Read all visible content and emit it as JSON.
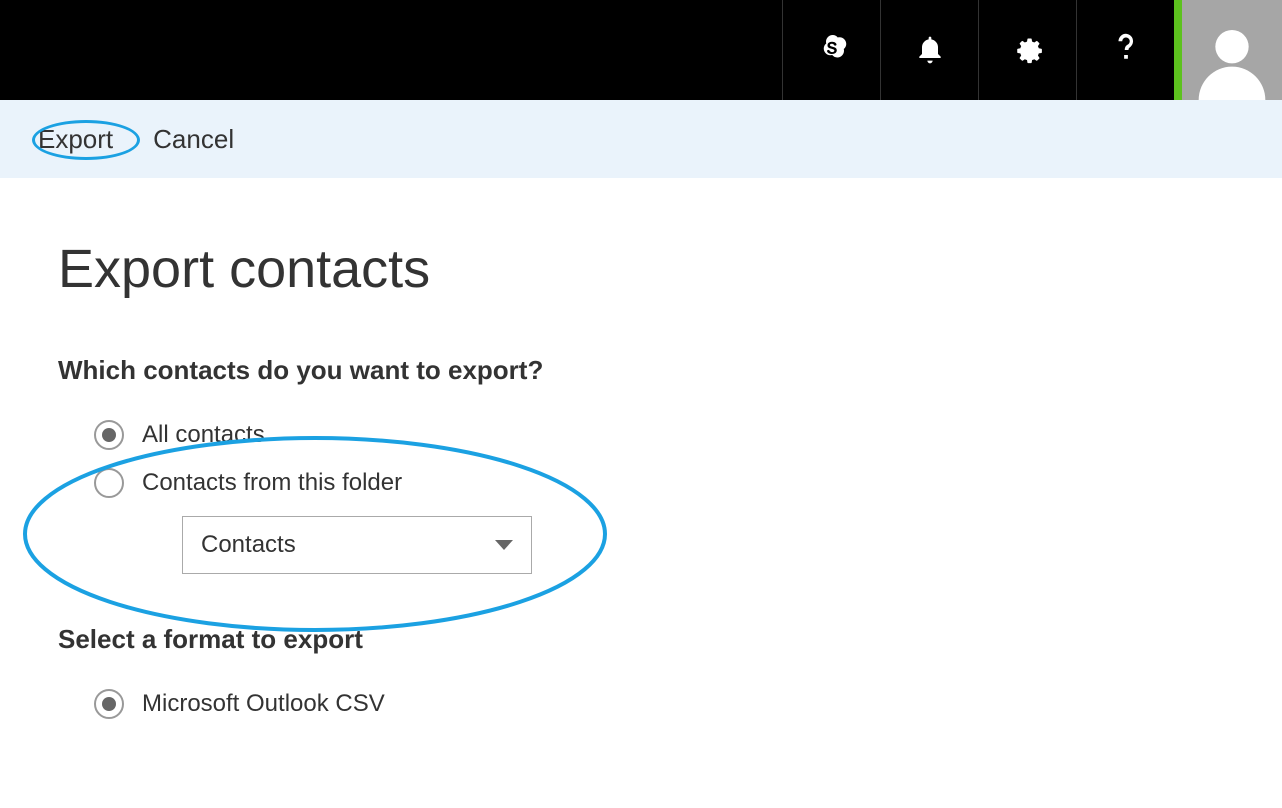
{
  "commandBar": {
    "export": "Export",
    "cancel": "Cancel"
  },
  "page": {
    "title": "Export contacts"
  },
  "section1": {
    "question": "Which contacts do you want to export?",
    "options": {
      "all": "All contacts",
      "folder": "Contacts from this folder"
    },
    "folderSelect": "Contacts"
  },
  "section2": {
    "label": "Select a format to export",
    "options": {
      "csv": "Microsoft Outlook CSV"
    }
  }
}
